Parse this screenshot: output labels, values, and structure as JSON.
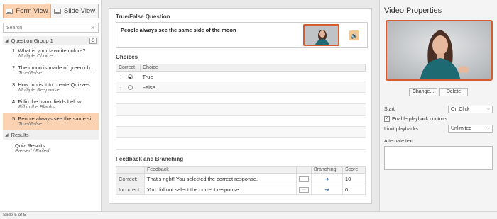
{
  "left": {
    "tabs": [
      {
        "label": "Form View"
      },
      {
        "label": "Slide View"
      }
    ],
    "search_placeholder": "Search",
    "group": {
      "label": "Question Group 1",
      "count": "5"
    },
    "questions": [
      {
        "title": "1. What is your favorite colore?",
        "type": "Multiple Choice"
      },
      {
        "title": "2. The moon is made of green che...",
        "type": "True/False"
      },
      {
        "title": "3. How fun is it to create Quizzes",
        "type": "Multiple Response"
      },
      {
        "title": "4. Fillin the blank fields below",
        "type": "Fill in the Blanks"
      },
      {
        "title": "5. People always see the same sid...",
        "type": "True/False"
      }
    ],
    "results_label": "Results",
    "results_item": {
      "title": "Quiz Results",
      "sub": "Passed / Failed"
    }
  },
  "status": "Slide 5 of 5",
  "question": {
    "section_title": "True/False Question",
    "text": "People always see the same side of the moon"
  },
  "choices": {
    "title": "Choices",
    "headers": {
      "correct": "Correct",
      "choice": "Choice"
    },
    "rows": [
      {
        "label": "True",
        "correct": true
      },
      {
        "label": "False",
        "correct": false
      }
    ]
  },
  "feedback": {
    "title": "Feedback and Branching",
    "headers": {
      "feedback": "Feedback",
      "branching": "Branching",
      "score": "Score"
    },
    "rows": [
      {
        "label": "Correct:",
        "text": "That's right! You selected the correct response.",
        "score": "10"
      },
      {
        "label": "Incorrect:",
        "text": "You did not select the correct response.",
        "score": "0"
      }
    ]
  },
  "props": {
    "title": "Video Properties",
    "change_btn": "Change...",
    "delete_btn": "Delete",
    "start_label": "Start:",
    "start_value": "On Click",
    "playback_controls_label": "Enable playback controls",
    "limit_label": "Limit playbacks:",
    "limit_value": "Unlimited",
    "alt_label": "Alternate text:"
  },
  "colors": {
    "accent": "#d65b2f",
    "selection": "#fbd2b2"
  }
}
